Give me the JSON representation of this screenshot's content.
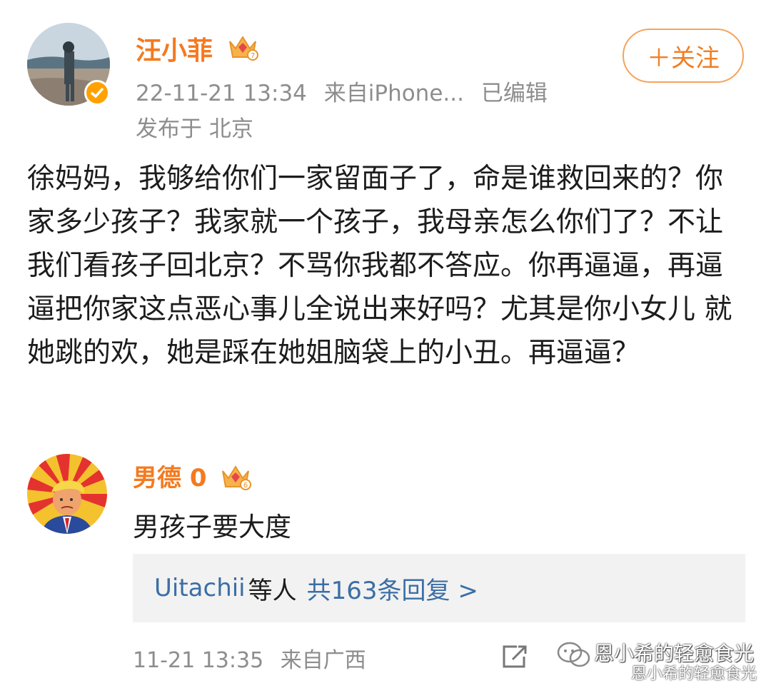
{
  "post": {
    "author": "汪小菲",
    "follow_label": "＋关注",
    "time": "22-11-21 13:34",
    "source": "来自iPhone...",
    "edited": "已编辑",
    "location": "发布于 北京",
    "text": "徐妈妈，我够给你们一家留面子了，命是谁救回来的？你家多少孩子？我家就一个孩子，我母亲怎么你们了？不让我们看孩子回北京？不骂你我都不答应。你再逼逼，再逼逼把你家这点恶心事儿全说出来好吗？尤其是你小女儿 就她跳的欢，她是踩在她姐脑袋上的小丑。再逼逼？"
  },
  "comment": {
    "author": "男德 0",
    "text": "男孩子要大度",
    "replies_user": "Uitachii",
    "replies_mid": "等人",
    "replies_count": "共163条回复 >",
    "time": "11-21 13:35",
    "source": "来自广西"
  },
  "watermark": {
    "line1": "恩小希的轻愈食光",
    "line2": "恩小希的轻愈食光"
  },
  "colors": {
    "accent_orange": "#f47a1f",
    "link_blue": "#3b6ea5",
    "meta_gray": "#8d8d8d"
  }
}
